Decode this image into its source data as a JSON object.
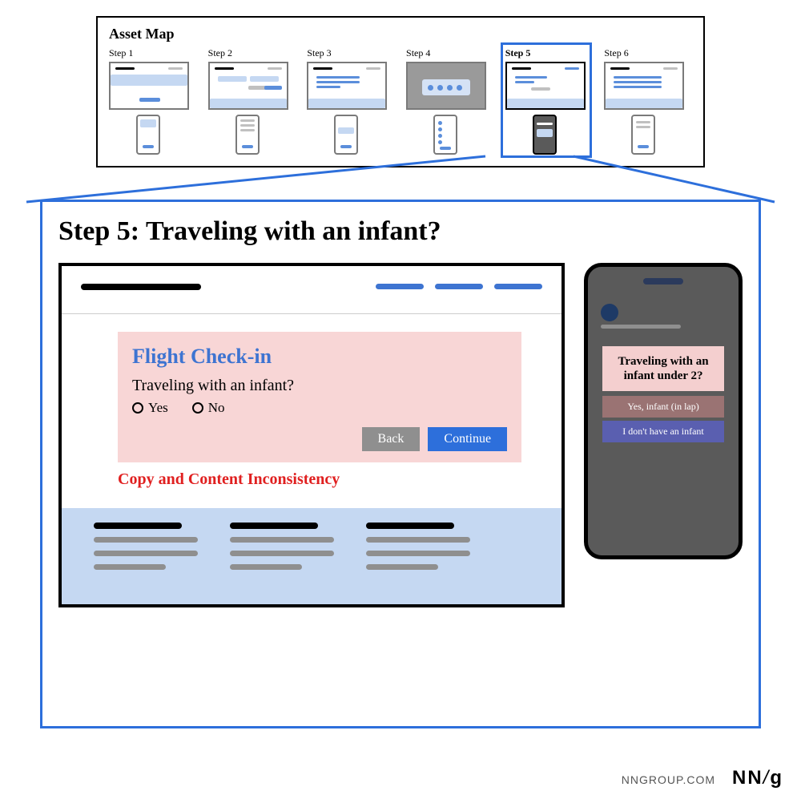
{
  "asset_map": {
    "title": "Asset Map",
    "steps": [
      {
        "label": "Step 1"
      },
      {
        "label": "Step 2"
      },
      {
        "label": "Step 3"
      },
      {
        "label": "Step 4"
      },
      {
        "label": "Step 5"
      },
      {
        "label": "Step 6"
      }
    ]
  },
  "detail": {
    "title": "Step 5: Traveling with an infant?",
    "desktop": {
      "card_title": "Flight Check-in",
      "question": "Traveling with an infant?",
      "option_yes": "Yes",
      "option_no": "No",
      "back_label": "Back",
      "continue_label": "Continue"
    },
    "inconsistency_label": "Copy and Content Inconsistency",
    "mobile": {
      "question": "Traveling with an infant under 2?",
      "option_a": "Yes, infant (in lap)",
      "option_b": "I don't have an infant"
    }
  },
  "branding": {
    "url": "NNGROUP.COM",
    "logo": "NN/g"
  }
}
